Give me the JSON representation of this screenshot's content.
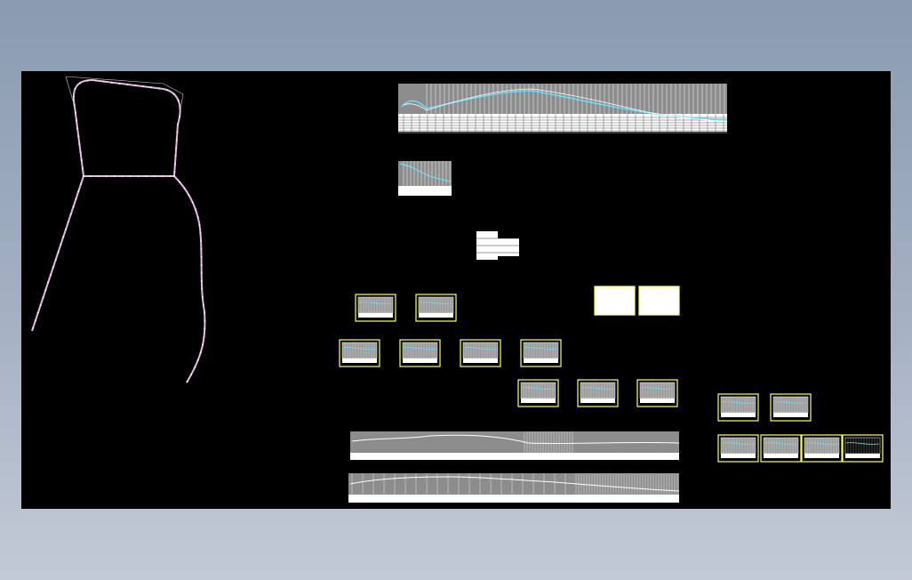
{
  "viewer": {
    "background": "#000000",
    "frame_color": "#ffff66",
    "road_color": "#e6b8e6",
    "profile_color": "#66e0ff"
  },
  "drawing": {
    "route_plan": {
      "type": "road-alignment-plan"
    },
    "sheets": {
      "profile_main": {
        "kind": "longitudinal-profile",
        "framed": false
      },
      "profile_small": {
        "kind": "longitudinal-profile",
        "framed": false
      },
      "title_block": {
        "kind": "table",
        "framed": false
      },
      "row_a": {
        "kind": "profile-sheet",
        "count": 2,
        "framed": true
      },
      "white_boxes": {
        "kind": "blank-sheet",
        "count": 2,
        "framed": true
      },
      "row_b": {
        "kind": "profile-sheet",
        "count": 4,
        "framed": true
      },
      "row_c": {
        "kind": "profile-sheet",
        "count": 3,
        "framed": true
      },
      "right_pair": {
        "kind": "profile-sheet",
        "count": 2,
        "framed": true
      },
      "right_row": {
        "kind": "profile-sheet",
        "count": 4,
        "framed": true
      },
      "long_strip_1": {
        "kind": "longitudinal-profile",
        "framed": false
      },
      "long_strip_2": {
        "kind": "longitudinal-profile",
        "framed": false
      }
    }
  }
}
